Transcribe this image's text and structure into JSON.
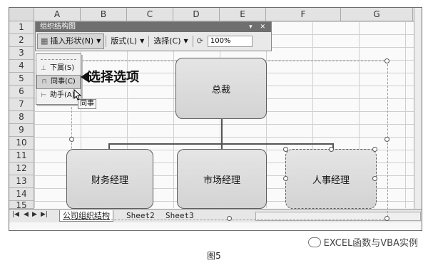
{
  "columns": [
    "A",
    "B",
    "C",
    "D",
    "E",
    "F",
    "G"
  ],
  "rows": [
    "1",
    "2",
    "3",
    "4",
    "5",
    "6",
    "7",
    "8",
    "9",
    "10",
    "11",
    "12",
    "13",
    "14",
    "15"
  ],
  "toolbar": {
    "title": "组织结构图",
    "insert_shape": "插入形状(N)",
    "layout": "版式(L)",
    "select": "选择(C)",
    "zoom": "100%"
  },
  "menu": {
    "items": [
      {
        "label": "下属(S)"
      },
      {
        "label": "同事(C)"
      },
      {
        "label": "助手(A)"
      }
    ],
    "tooltip": "同事"
  },
  "callout": "选择选项",
  "org_chart": {
    "top": "总裁",
    "children": [
      "财务经理",
      "市场经理",
      "人事经理"
    ]
  },
  "sheet_tabs": [
    "公司组织结构",
    "Sheet2",
    "Sheet3"
  ],
  "caption": "图5",
  "watermark": "EXCEL函数与VBA实例"
}
